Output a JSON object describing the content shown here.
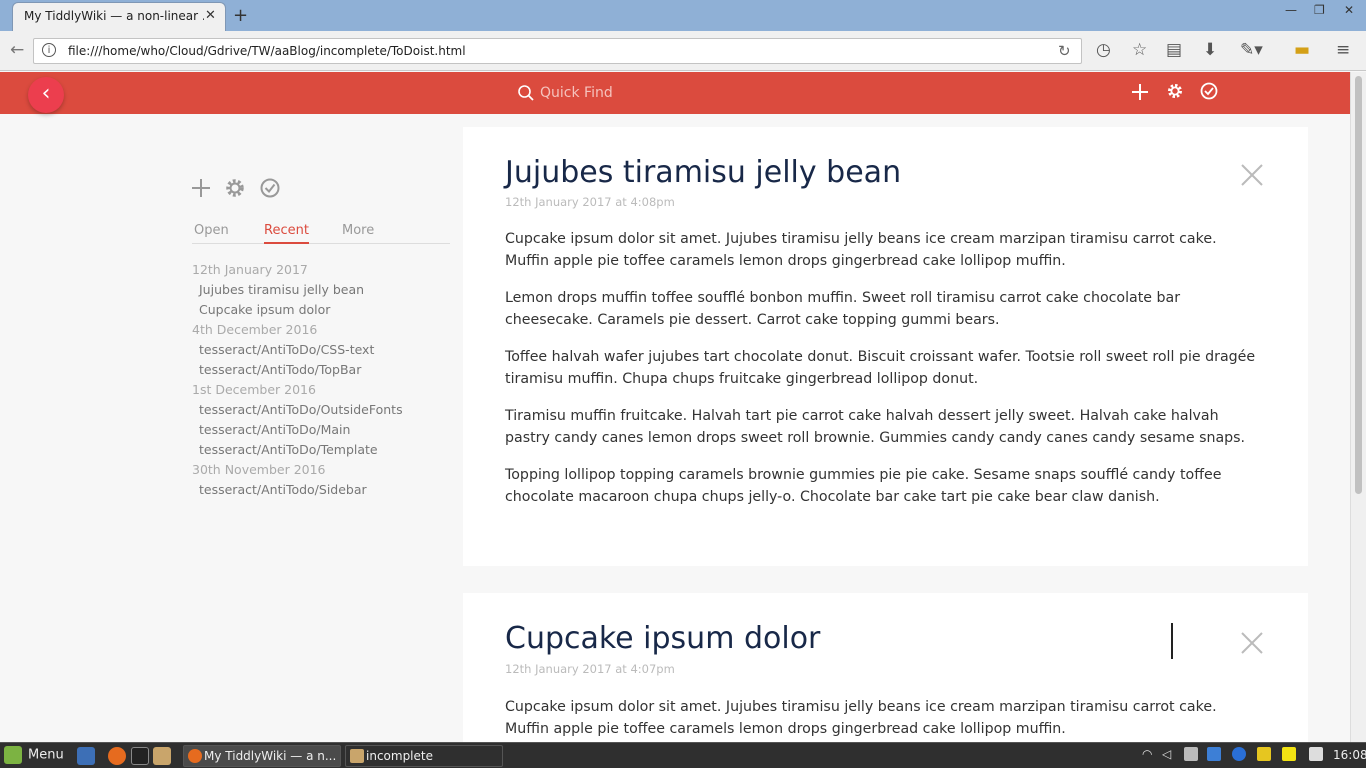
{
  "browser": {
    "tab_title": "My TiddlyWiki — a non-linear ...",
    "url": "file:///home/who/Cloud/Gdrive/TW/aaBlog/incomplete/ToDoist.html"
  },
  "topbar": {
    "search_placeholder": "Quick Find"
  },
  "sidebar": {
    "tabs": [
      {
        "label": "Open"
      },
      {
        "label": "Recent"
      },
      {
        "label": "More"
      }
    ],
    "groups": [
      {
        "date": "12th January 2017",
        "items": [
          "Jujubes tiramisu jelly bean",
          "Cupcake ipsum dolor"
        ]
      },
      {
        "date": "4th December 2016",
        "items": [
          "tesseract/AntiToDo/CSS-text",
          "tesseract/AntiTodo/TopBar"
        ]
      },
      {
        "date": "1st December 2016",
        "items": [
          "tesseract/AntiToDo/OutsideFonts",
          "tesseract/AntiToDo/Main",
          "tesseract/AntiToDo/Template"
        ]
      },
      {
        "date": "30th November 2016",
        "items": [
          "tesseract/AntiTodo/Sidebar"
        ]
      }
    ]
  },
  "tiddlers": [
    {
      "title": "Jujubes tiramisu jelly bean",
      "date": "12th January 2017 at 4:08pm",
      "paragraphs": [
        "Cupcake ipsum dolor sit amet. Jujubes tiramisu jelly beans ice cream marzipan tiramisu carrot cake. Muffin apple pie toffee caramels lemon drops gingerbread cake lollipop muffin.",
        "Lemon drops muffin toffee soufflé bonbon muffin. Sweet roll tiramisu carrot cake chocolate bar cheesecake. Caramels pie dessert. Carrot cake topping gummi bears.",
        "Toffee halvah wafer jujubes tart chocolate donut. Biscuit croissant wafer. Tootsie roll sweet roll pie dragée tiramisu muffin. Chupa chups fruitcake gingerbread lollipop donut.",
        "Tiramisu muffin fruitcake. Halvah tart pie carrot cake halvah dessert jelly sweet. Halvah cake halvah pastry candy canes lemon drops sweet roll brownie. Gummies candy candy canes candy sesame snaps.",
        "Topping lollipop topping caramels brownie gummies pie pie cake. Sesame snaps soufflé candy toffee chocolate macaroon chupa chups jelly-o. Chocolate bar cake tart pie cake bear claw danish."
      ]
    },
    {
      "title": "Cupcake ipsum dolor",
      "date": "12th January 2017 at 4:07pm",
      "paragraphs": [
        "Cupcake ipsum dolor sit amet. Jujubes tiramisu jelly beans ice cream marzipan tiramisu carrot cake. Muffin apple pie toffee caramels lemon drops gingerbread cake lollipop muffin."
      ]
    }
  ],
  "taskbar": {
    "menu_label": "Menu",
    "tasks": [
      {
        "label": "My TiddlyWiki — a n..."
      },
      {
        "label": "incomplete"
      }
    ],
    "clock": "16:08"
  },
  "colors": {
    "accent": "#db4b3e",
    "title": "#182848",
    "back_button": "#ec3e4e"
  }
}
